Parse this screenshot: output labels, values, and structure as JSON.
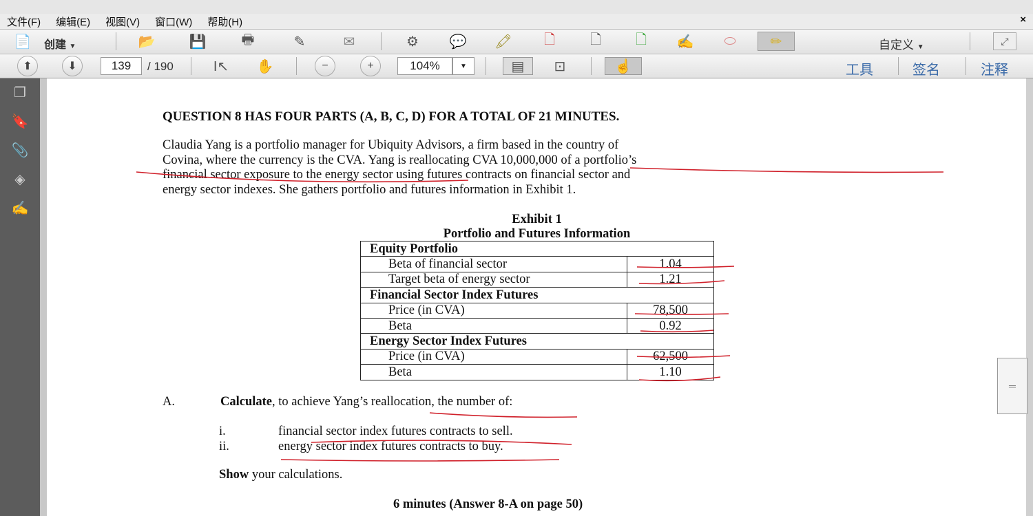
{
  "menu": [
    "文件(F)",
    "编辑(E)",
    "视图(V)",
    "窗口(W)",
    "帮助(H)"
  ],
  "close_label": "×",
  "toolbar": {
    "create_label": "创建",
    "customize_label": "自定义"
  },
  "nav": {
    "page": "139",
    "total": "/ 190",
    "zoom": "104%"
  },
  "right_tabs": [
    "工具",
    "签名",
    "注释"
  ],
  "doc": {
    "title": "QUESTION 8 HAS FOUR PARTS (A, B, C, D) FOR A TOTAL OF 21 MINUTES.",
    "para": [
      "Claudia Yang is a portfolio manager for Ubiquity Advisors, a firm based in the country of",
      "Covina, where the currency is the CVA. Yang is reallocating CVA 10,000,000 of a portfolio’s",
      "financial sector exposure to the energy sector using futures contracts on financial sector and",
      "energy sector indexes. She gathers portfolio and futures information in Exhibit 1."
    ],
    "exhibit_title": "Exhibit 1",
    "exhibit_sub": "Portfolio and Futures Information",
    "table": [
      {
        "h": "Equity Portfolio"
      },
      {
        "l": "Beta of financial sector",
        "v": "1.04"
      },
      {
        "l": "Target beta of energy sector",
        "v": "1.21"
      },
      {
        "h": "Financial Sector Index Futures"
      },
      {
        "l": "Price (in CVA)",
        "v": "78,500"
      },
      {
        "l": "Beta",
        "v": "0.92"
      },
      {
        "h": "Energy Sector Index Futures"
      },
      {
        "l": "Price (in CVA)",
        "v": "62,500"
      },
      {
        "l": "Beta",
        "v": "1.10"
      }
    ],
    "partA_label": "A.",
    "partA_bold": "Calculate",
    "partA_rest": ", to achieve Yang’s reallocation, the number of:",
    "items": [
      {
        "n": "i.",
        "t": "financial sector index futures contracts to sell."
      },
      {
        "n": "ii.",
        "t": "energy sector index futures contracts to buy."
      }
    ],
    "show_bold": "Show",
    "show_rest": " your calculations.",
    "footer": "6 minutes (Answer 8-A on page 50)"
  },
  "annotation_color": "#d0202a"
}
